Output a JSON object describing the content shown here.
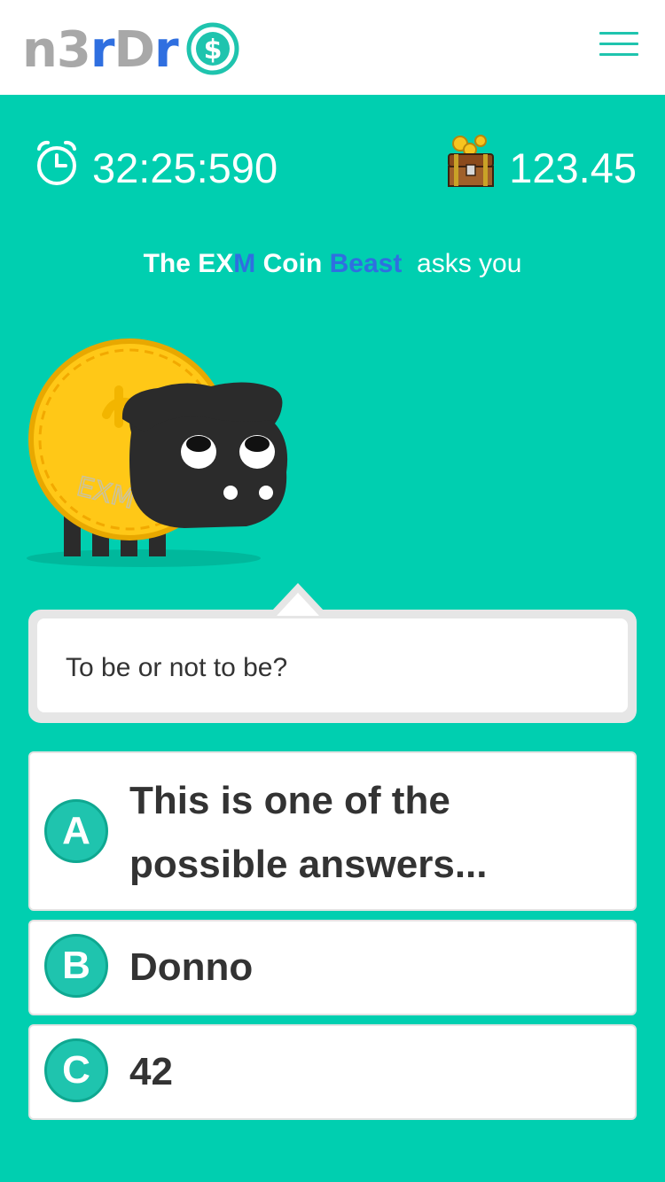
{
  "header": {
    "logo_part1": "n3",
    "logo_part2": "r",
    "logo_part3": "D",
    "logo_part4": "r",
    "logo_icon": "dollar-coin-icon",
    "menu_icon": "hamburger-menu-icon"
  },
  "status": {
    "timer": "32:25:590",
    "timer_icon": "alarm-clock-icon",
    "balance": "123.45",
    "balance_icon": "treasure-chest-icon"
  },
  "prompt": {
    "the_ex": "The EX",
    "m": "M",
    "coin": "Coin",
    "beast": "Beast",
    "asks_you": "asks you"
  },
  "beast": {
    "coin_label": "EXM"
  },
  "question": {
    "text": "To be or not to be?"
  },
  "answers": [
    {
      "letter": "A",
      "line1": "This is one of the",
      "line2": "possible answers..."
    },
    {
      "letter": "B",
      "text": "Donno"
    },
    {
      "letter": "C",
      "text": "42"
    }
  ],
  "colors": {
    "background": "#00CFB0",
    "accent": "#1FC4AE",
    "blue": "#2F6FE0",
    "logo_gray": "#A8A8A8"
  }
}
